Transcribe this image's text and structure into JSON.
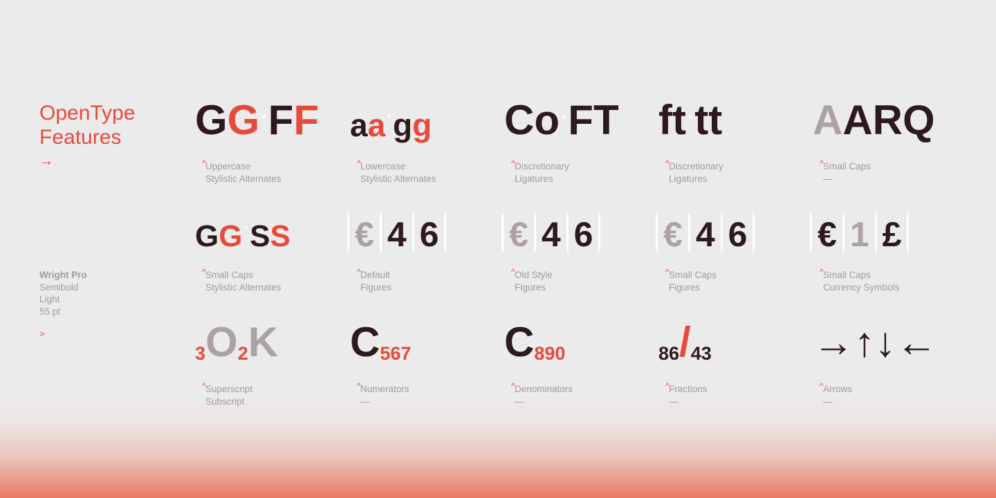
{
  "header": {
    "title_line1": "OpenType",
    "title_line2": "Features",
    "arrow": "→"
  },
  "font_info": {
    "name": "Wright Pro",
    "weight1": "Semibold",
    "weight2": "Light",
    "size": "55 pt",
    "arrow": ">"
  },
  "colors": {
    "background": "#ebebeb",
    "accent": "#e8493a",
    "dark": "#2e1a1e",
    "muted": "#aca2a2",
    "caption": "#a39a9a"
  },
  "features": [
    {
      "specimen": [
        {
          "t": "G",
          "c": "d"
        },
        {
          "t": "G",
          "c": "r"
        },
        {
          "t": "•",
          "c": "w"
        },
        {
          "t": "F",
          "c": "d"
        },
        {
          "t": "F",
          "c": "r"
        }
      ],
      "line1": "Uppercase",
      "line2": "Stylistic Alternates"
    },
    {
      "specimen": [
        {
          "t": "a",
          "c": "d"
        },
        {
          "t": "a",
          "c": "r"
        },
        {
          "t": "•",
          "c": "w"
        },
        {
          "t": "g",
          "c": "d"
        },
        {
          "t": "g",
          "c": "r"
        }
      ],
      "line1": "Lowercase",
      "line2": "Stylistic Alternates"
    },
    {
      "specimen": [
        {
          "t": "Co",
          "c": "d"
        },
        {
          "t": "•",
          "c": "w"
        },
        {
          "t": "FT",
          "c": "d"
        }
      ],
      "line1": "Discretionary",
      "line2": "Ligatures"
    },
    {
      "specimen": [
        {
          "t": "ft",
          "c": "d"
        },
        {
          "t": "•",
          "c": "w"
        },
        {
          "t": "tt",
          "c": "d"
        }
      ],
      "line1": "Discretionary",
      "line2": "Ligatures"
    },
    {
      "specimen": [
        {
          "t": "A",
          "c": "g"
        },
        {
          "t": "ARQ",
          "c": "d"
        }
      ],
      "line1": "Small Caps",
      "line2": "—"
    },
    {
      "specimen": [
        {
          "t": "G",
          "c": "d"
        },
        {
          "t": "G",
          "c": "r"
        },
        {
          "t": "•",
          "c": "w"
        },
        {
          "t": "S",
          "c": "d"
        },
        {
          "t": "S",
          "c": "r"
        }
      ],
      "line1": "Small Caps",
      "line2": "Stylistic Alternates"
    },
    {
      "figures": [
        {
          "t": "€",
          "c": "g"
        },
        {
          "t": "4",
          "c": "d"
        },
        {
          "t": "6",
          "c": "d"
        }
      ],
      "line1": "Default",
      "line2": "Figures"
    },
    {
      "figures": [
        {
          "t": "€",
          "c": "g"
        },
        {
          "t": "4",
          "c": "d"
        },
        {
          "t": "6",
          "c": "d"
        }
      ],
      "line1": "Old Style",
      "line2": "Figures"
    },
    {
      "figures": [
        {
          "t": "€",
          "c": "g"
        },
        {
          "t": "4",
          "c": "d"
        },
        {
          "t": "6",
          "c": "d"
        }
      ],
      "line1": "Small Caps",
      "line2": "Figures"
    },
    {
      "figures": [
        {
          "t": "€",
          "c": "d"
        },
        {
          "t": "1",
          "c": "g"
        },
        {
          "t": "£",
          "c": "d"
        }
      ],
      "line1": "Small Caps",
      "line2": "Currency Symbols"
    },
    {
      "specimen": [
        {
          "t": "3",
          "c": "r",
          "s": "sup"
        },
        {
          "t": "O",
          "c": "g"
        },
        {
          "t": "2",
          "c": "r",
          "s": "sub"
        },
        {
          "t": "K",
          "c": "g"
        }
      ],
      "line1": "Superscript",
      "line2": "Subscript"
    },
    {
      "specimen": [
        {
          "t": "C",
          "c": "d"
        },
        {
          "t": "567",
          "c": "r",
          "s": "sup"
        }
      ],
      "line1": "Numerators",
      "line2": "—"
    },
    {
      "specimen": [
        {
          "t": "C",
          "c": "d"
        },
        {
          "t": "890",
          "c": "r",
          "s": "sub"
        }
      ],
      "line1": "Denominators",
      "line2": "—"
    },
    {
      "specimen": [
        {
          "t": "86",
          "c": "d",
          "s": "sup"
        },
        {
          "t": "/",
          "c": "r"
        },
        {
          "t": "43",
          "c": "d",
          "s": "sub"
        }
      ],
      "line1": "Fractions",
      "line2": "—"
    },
    {
      "specimen": [
        {
          "t": "→↑↓←",
          "c": "d"
        }
      ],
      "line1": "Arrows",
      "line2": "—"
    }
  ]
}
